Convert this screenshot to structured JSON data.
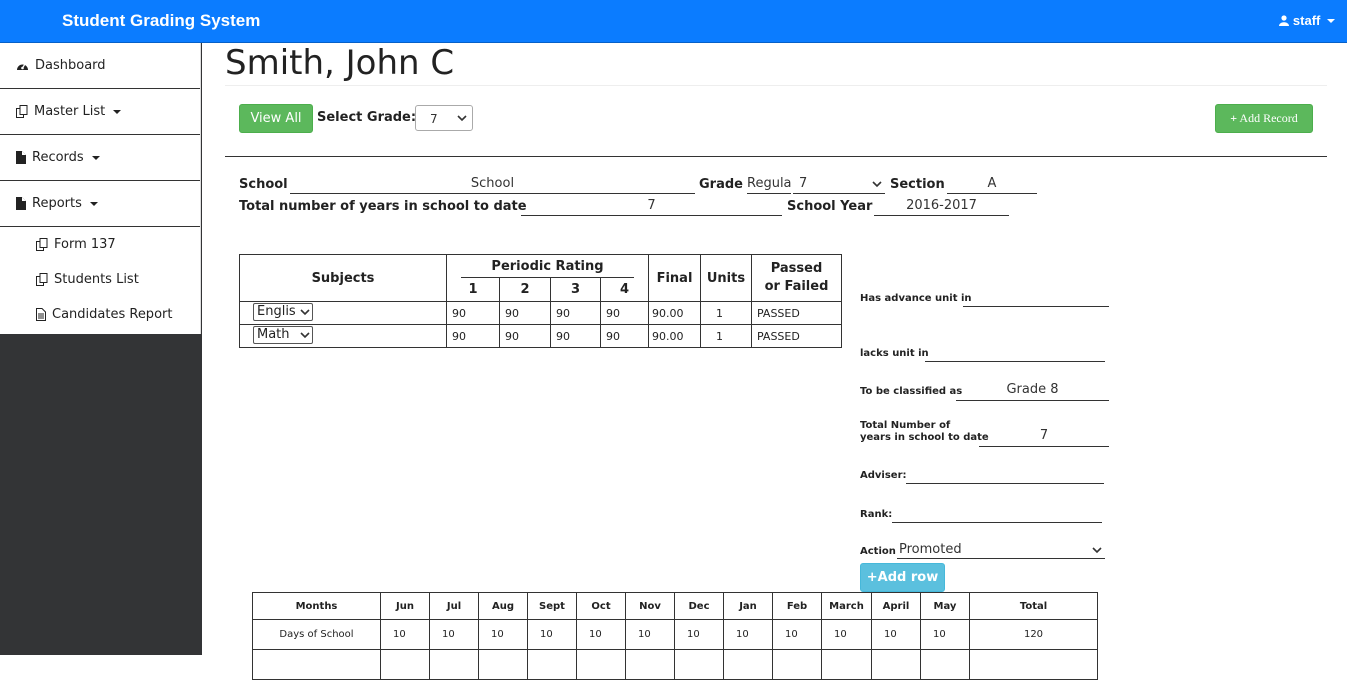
{
  "header": {
    "brand": "Student Grading System",
    "user": "staff"
  },
  "sidebar": {
    "items": [
      {
        "label": "Dashboard",
        "icon": "dashboard-icon"
      },
      {
        "label": "Master List",
        "icon": "copy-icon"
      },
      {
        "label": "Records",
        "icon": "file-icon"
      },
      {
        "label": "Reports",
        "icon": "file-icon"
      }
    ],
    "subitems": [
      {
        "label": "Form 137",
        "icon": "copy-icon"
      },
      {
        "label": "Students List",
        "icon": "copy-icon"
      },
      {
        "label": "Candidates Report",
        "icon": "file-text-icon"
      }
    ]
  },
  "student": {
    "name": "Smith, John C"
  },
  "toolbar": {
    "view_all": "View All",
    "select_grade_label": "Select Grade:",
    "grade_value": "7",
    "add_record": "Add Record"
  },
  "info": {
    "school_label": "School",
    "school_value": "School",
    "grade_label": "Grade",
    "grade_type": "Regula",
    "grade_value": "7",
    "section_label": "Section",
    "section_value": "A",
    "years_label": "Total number of years in school to date",
    "years_value": "7",
    "sy_label": "School Year",
    "sy_value": "2016-2017"
  },
  "grades": {
    "headers": {
      "subjects": "Subjects",
      "periodic": "Periodic Rating",
      "p1": "1",
      "p2": "2",
      "p3": "3",
      "p4": "4",
      "final": "Final",
      "units": "Units",
      "passed1": "Passed",
      "passed2": "or Failed"
    },
    "rows": [
      {
        "subject": "Englis",
        "r1": "90",
        "r2": "90",
        "r3": "90",
        "r4": "90",
        "final": "90.00",
        "units": "1",
        "status": "PASSED"
      },
      {
        "subject": "Math",
        "r1": "90",
        "r2": "90",
        "r3": "90",
        "r4": "90",
        "final": "90.00",
        "units": "1",
        "status": "PASSED"
      }
    ]
  },
  "side_form": {
    "advance": "Has advance unit in",
    "lacks": "lacks unit in",
    "classified": "To be classified as",
    "classified_value": "Grade 8",
    "total1": "Total Number of",
    "total2": "years in school to date",
    "total_value": "7",
    "adviser": "Adviser:",
    "rank": "Rank:",
    "action": "Action",
    "action_value": "Promoted",
    "add_row": "Add row"
  },
  "attendance": {
    "headers": [
      "Months",
      "Jun",
      "Jul",
      "Aug",
      "Sept",
      "Oct",
      "Nov",
      "Dec",
      "Jan",
      "Feb",
      "March",
      "April",
      "May",
      "Total"
    ],
    "row": [
      "Days of School",
      "10",
      "10",
      "10",
      "10",
      "10",
      "10",
      "10",
      "10",
      "10",
      "10",
      "10",
      "10",
      "120"
    ]
  },
  "colors": {
    "navbar": "#0b7cff",
    "success": "#5cb85c",
    "info": "#5bc0de",
    "sidebar_dark": "#333436"
  }
}
